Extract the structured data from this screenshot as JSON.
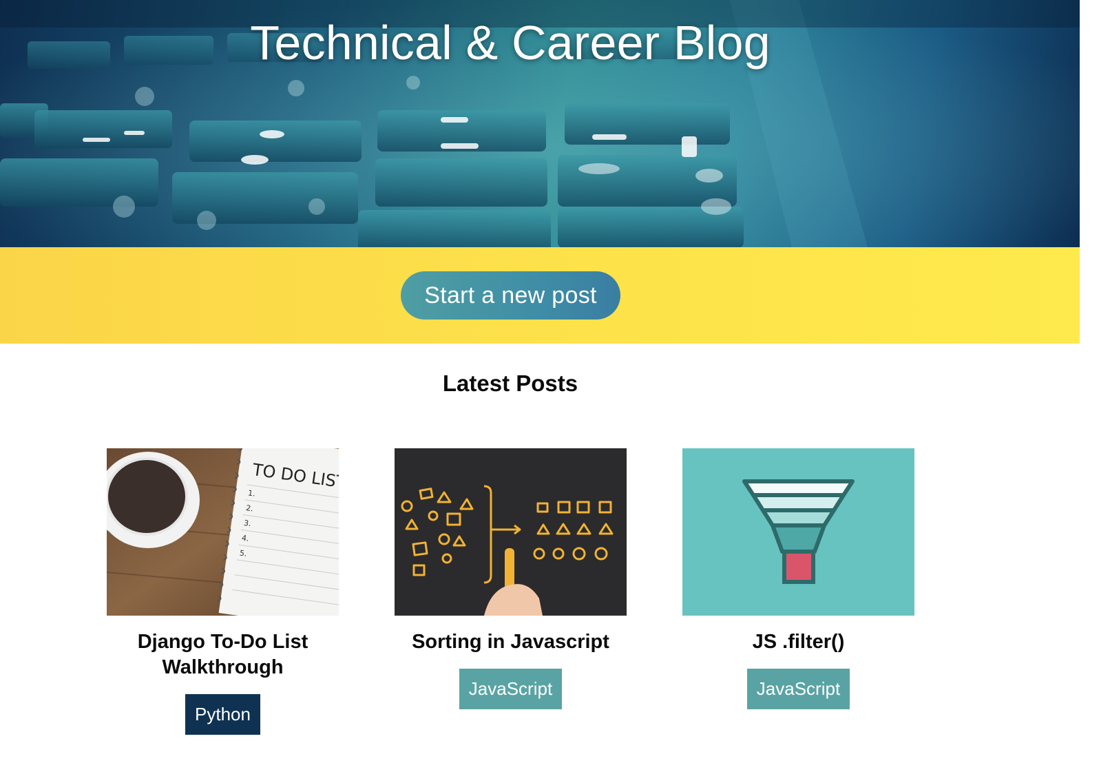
{
  "header": {
    "title": "Technical & Career Blog"
  },
  "cta": {
    "new_post_label": "Start a new post"
  },
  "latest": {
    "heading": "Latest Posts",
    "posts": [
      {
        "title": "Django To-Do List Walkthrough",
        "tag": "Python",
        "image": "to-do-list-notebook-and-coffee",
        "image_text": "TO DO LIST"
      },
      {
        "title": "Sorting in Javascript",
        "tag": "JavaScript",
        "image": "chalkboard-sorting-shapes"
      },
      {
        "title": "JS .filter()",
        "tag": "JavaScript",
        "image": "funnel-illustration"
      }
    ]
  },
  "colors": {
    "hero_accent": "#2d8a93",
    "cta_band": "#fde24a",
    "button": "#4f9ea3",
    "tag_python": "#0f3252",
    "tag_javascript": "#5aa3a4",
    "funnel_background": "#67c3c0"
  }
}
